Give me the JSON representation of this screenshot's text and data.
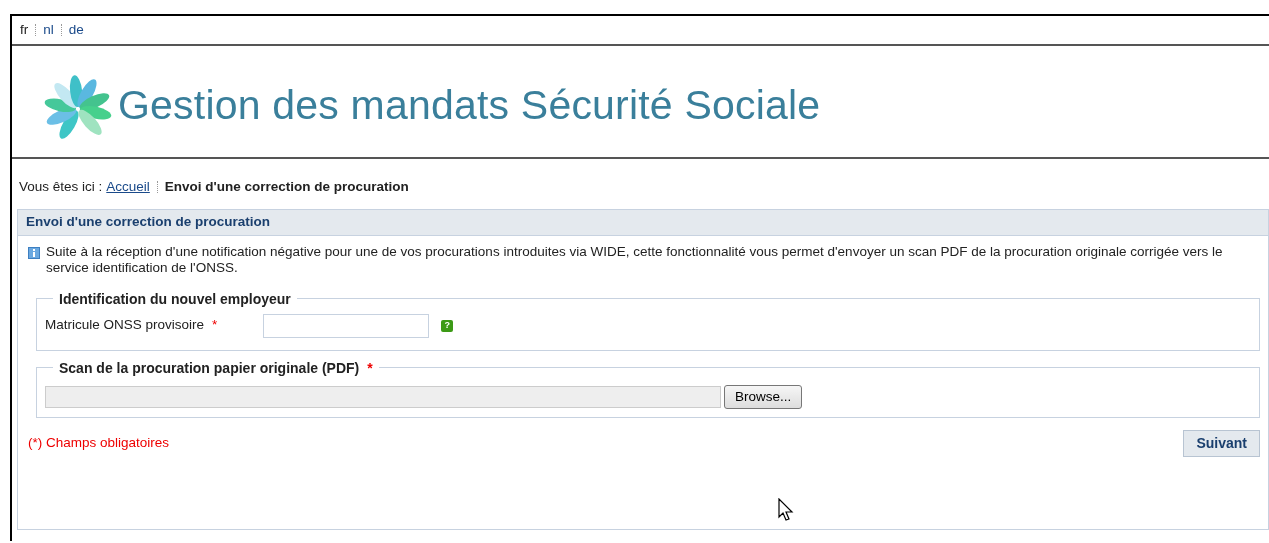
{
  "languages": [
    {
      "label": "fr",
      "selected": true
    },
    {
      "label": "nl",
      "selected": false
    },
    {
      "label": "de",
      "selected": false
    }
  ],
  "site_title": "Gestion des mandats Sécurité Sociale",
  "breadcrumb": {
    "prefix": "Vous êtes ici :",
    "link": "Accueil",
    "current": "Envoi d'une correction de procuration"
  },
  "panel": {
    "title": "Envoi d'une correction de procuration",
    "info": "Suite à la réception d'une notification négative pour une de vos procurations introduites via WIDE, cette fonctionnalité vous permet d'envoyer un scan PDF de la procuration originale corrigée vers le service identification de l'ONSS.",
    "sections": [
      {
        "legend": "Identification du nouvel employeur",
        "kind": "text",
        "label": "Matricule ONSS provisoire",
        "label_marker": "*",
        "help": "?"
      },
      {
        "legend": "Scan de la procuration papier originale (PDF)",
        "legend_marker": "*",
        "kind": "file",
        "button": "Browse..."
      }
    ],
    "required_note": "(*) Champs obligatoires",
    "next_button": "Suivant"
  }
}
